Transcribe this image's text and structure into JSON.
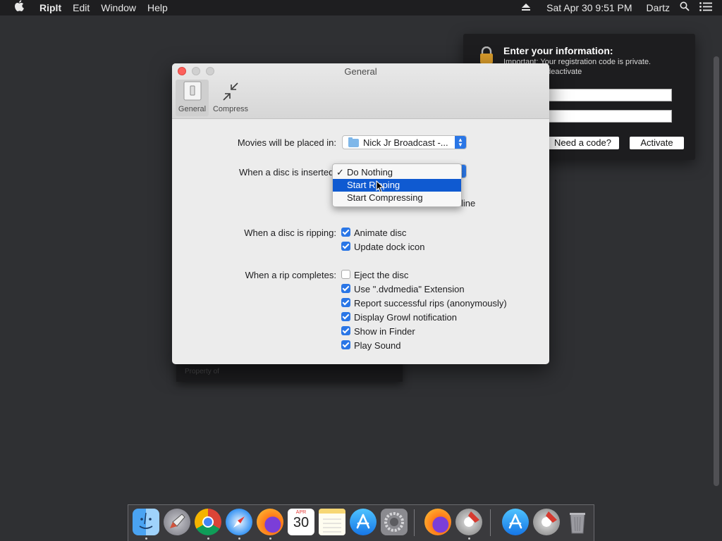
{
  "menubar": {
    "app": "RipIt",
    "items": [
      "Edit",
      "Window",
      "Help"
    ],
    "datetime": "Sat Apr 30  9:51 PM",
    "user": "Dartz"
  },
  "registration": {
    "title": "Enter your information:",
    "subtitle": "Important: Your registration code is private.",
    "subtitle2": "ll cause it to deactivate",
    "need_code": "Need a code?",
    "activate": "Activate"
  },
  "ghost": {
    "text": "Property of"
  },
  "window": {
    "title": "General",
    "toolbar": [
      {
        "label": "General",
        "selected": true
      },
      {
        "label": "Compress",
        "selected": false
      }
    ],
    "movies_label": "Movies will be placed in:",
    "movies_value": "Nick Jr Broadcast -...",
    "disc_inserted_label": "When a disc is inserted:",
    "hidden_option1_tail": "s",
    "hidden_option2_tail": "line",
    "menu": {
      "options": [
        "Do Nothing",
        "Start Ripping",
        "Start Compressing"
      ],
      "checked": "Do Nothing",
      "highlighted": "Start Ripping",
      "checkmark": "✓"
    },
    "ripping_label": "When a disc is ripping:",
    "ripping_options": [
      {
        "label": "Animate disc",
        "checked": true
      },
      {
        "label": "Update dock icon",
        "checked": true
      }
    ],
    "completes_label": "When a rip completes:",
    "completes_options": [
      {
        "label": "Eject the disc",
        "checked": false
      },
      {
        "label": "Use \".dvdmedia\" Extension",
        "checked": true
      },
      {
        "label": "Report successful rips (anonymously)",
        "checked": true
      },
      {
        "label": "Display Growl notification",
        "checked": true
      },
      {
        "label": "Show in Finder",
        "checked": true
      },
      {
        "label": "Play Sound",
        "checked": true
      }
    ]
  },
  "dock": {
    "calendar_month": "APR",
    "calendar_day": "30",
    "icons": [
      "finder-icon",
      "launchpad-icon",
      "chrome-icon",
      "safari-icon",
      "firefox-icon",
      "calendar-icon",
      "notes-icon",
      "app-store-icon",
      "system-preferences-icon",
      "firefox-icon",
      "ripit-icon",
      "app-store-icon",
      "ripit-icon",
      "trash-icon"
    ]
  },
  "colors": {
    "accent": "#2a76e6",
    "menu_highlight": "#0f5ad1",
    "close": "#fc605b",
    "desktop": "#2f3033"
  }
}
